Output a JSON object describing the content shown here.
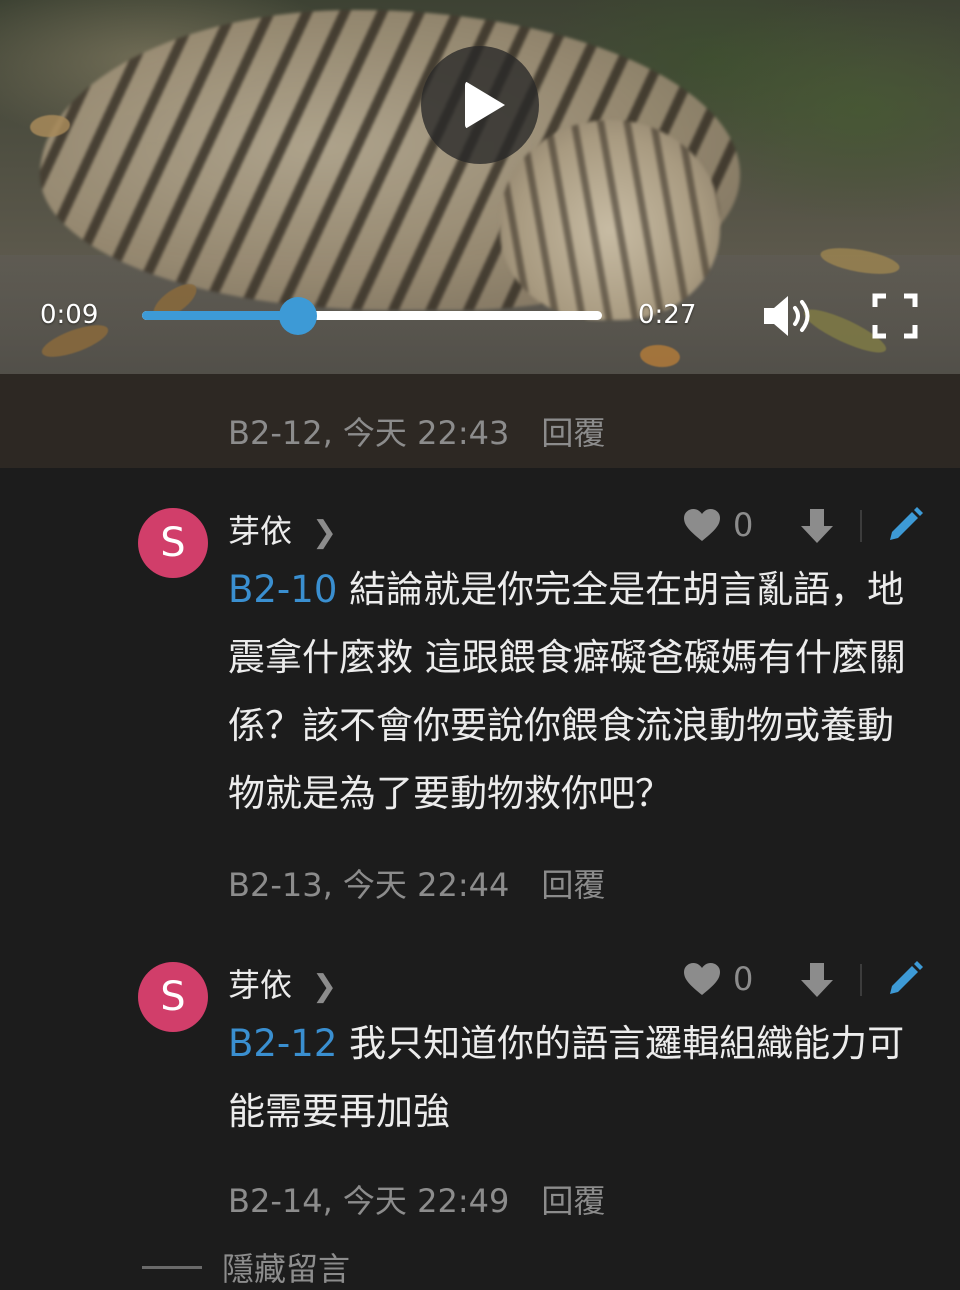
{
  "video": {
    "current_time": "0:09",
    "duration": "0:27",
    "progress": 0.34,
    "icons": [
      "play-icon",
      "volume-icon",
      "fullscreen-icon"
    ]
  },
  "meta_top": {
    "floor": "B2-12, 今天 22:43",
    "reply_label": "回覆"
  },
  "comments": [
    {
      "avatar_letter": "S",
      "username": "芽依",
      "like_count": "0",
      "mention": "B2-10",
      "text": "結論就是你完全是在胡言亂語，地震拿什麼救 這跟餵食癖礙爸礙媽有什麼關係？該不會你要說你餵食流浪動物或養動物就是為了要動物救你吧？",
      "meta": "B2-13, 今天 22:44",
      "reply_label": "回覆"
    },
    {
      "avatar_letter": "S",
      "username": "芽依",
      "like_count": "0",
      "mention": "B2-12",
      "text": "我只知道你的語言邏輯組織能力可能需要再加強",
      "meta": "B2-14, 今天 22:49",
      "reply_label": "回覆"
    }
  ],
  "hide_comments_label": "隱藏留言",
  "colors": {
    "accent": "#3d9ad6",
    "mention": "#3a8fd0",
    "avatar": "#d13e6a",
    "background": "#1c1c1c",
    "meta_strip": "#2d2823",
    "muted_text": "#8c8c8c"
  }
}
